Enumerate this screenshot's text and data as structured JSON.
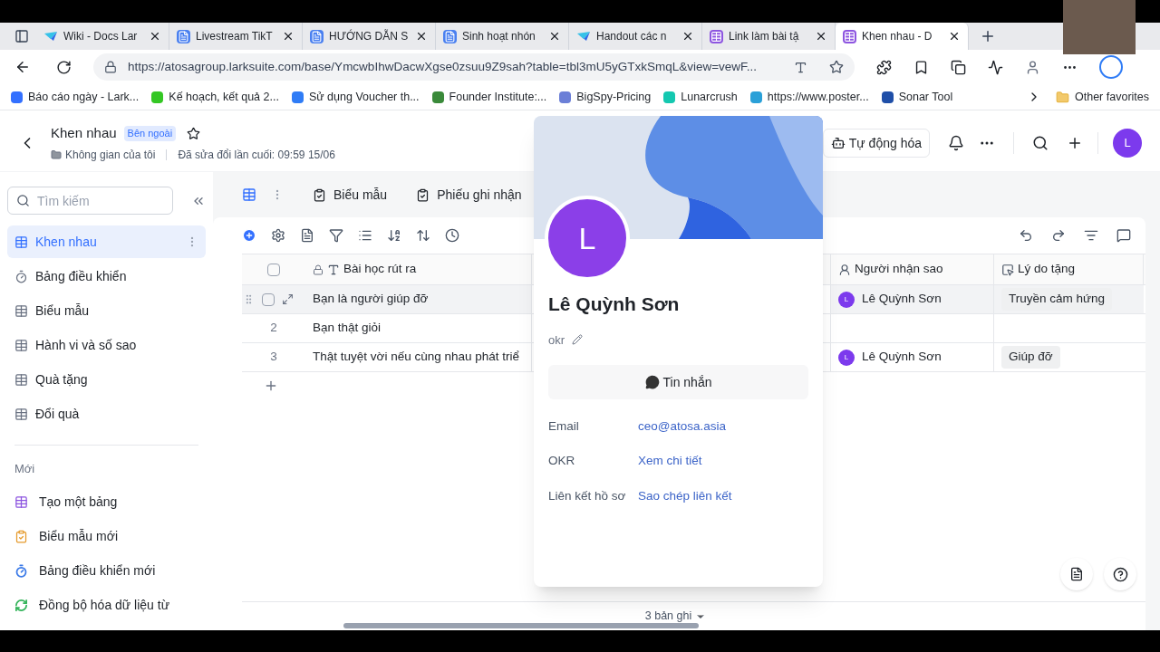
{
  "browser": {
    "tabs": [
      {
        "label": "Wiki - Docs Lar",
        "kind": "lark",
        "selected": false
      },
      {
        "label": "Livestream TikT",
        "kind": "doc",
        "selected": false
      },
      {
        "label": "HƯỚNG DẪN S",
        "kind": "doc",
        "selected": false
      },
      {
        "label": "Sinh hoạt nhón",
        "kind": "doc",
        "selected": false
      },
      {
        "label": "Handout các n",
        "kind": "lark",
        "selected": false
      },
      {
        "label": "Link làm bài tậ",
        "kind": "base",
        "selected": false
      },
      {
        "label": "Khen nhau - D",
        "kind": "base",
        "selected": true
      }
    ],
    "url": "https://atosagroup.larksuite.com/base/YmcwbIhwDacwXgse0zsuu9Z9sah?table=tbl3mU5yGTxkSmqL&view=vewF...",
    "bookmarks": [
      {
        "label": "Báo cáo ngày - Lark...",
        "color": "#3370ff"
      },
      {
        "label": "Kế hoạch, kết quả 2...",
        "color": "#34c724"
      },
      {
        "label": "Sử dụng Voucher th...",
        "color": "#2f7cf6"
      },
      {
        "label": "Founder Institute:...",
        "color": "#3a8a3a"
      },
      {
        "label": "BigSpy-Pricing",
        "color": "#6b7fd7"
      },
      {
        "label": "Lunarcrush",
        "color": "#14c8b0"
      },
      {
        "label": "https://www.poster...",
        "color": "#2aa0d8"
      },
      {
        "label": "Sonar Tool",
        "color": "#1f4fa8"
      }
    ],
    "other_favorites": "Other favorites"
  },
  "header": {
    "title": "Khen nhau",
    "badge": "Bên ngoài",
    "location": "Không gian của tôi",
    "modified": "Đã sửa đổi lần cuối: 09:59 15/06",
    "automation": "Tự động hóa",
    "avatar": "L"
  },
  "sidebar": {
    "search_placeholder": "Tìm kiếm",
    "items": [
      {
        "label": "Khen nhau",
        "kind": "table",
        "selected": true
      },
      {
        "label": "Bảng điều khiển",
        "kind": "dashboard",
        "selected": false
      },
      {
        "label": "Biểu mẫu",
        "kind": "table",
        "selected": false
      },
      {
        "label": "Hành vi và số sao",
        "kind": "table",
        "selected": false
      },
      {
        "label": "Quà tặng",
        "kind": "table",
        "selected": false
      },
      {
        "label": "Đổi quà",
        "kind": "table",
        "selected": false
      }
    ],
    "new_section": "Mới",
    "new_items": [
      {
        "label": "Tạo một bảng",
        "kind": "table",
        "color": "#8d55e0"
      },
      {
        "label": "Biểu mẫu mới",
        "kind": "form",
        "color": "#e59a2b"
      },
      {
        "label": "Bảng điều khiển mới",
        "kind": "dashboard",
        "color": "#3c7be8"
      },
      {
        "label": "Đồng bộ hóa dữ liệu từ",
        "kind": "sync",
        "color": "#34b45a"
      }
    ]
  },
  "views": [
    {
      "label": "Biểu mẫu"
    },
    {
      "label": "Phiếu ghi nhận"
    }
  ],
  "table": {
    "all_selected": false,
    "columns": [
      {
        "label": "Bài học rút ra",
        "kind": "text"
      },
      {
        "label": "Người nhận sao",
        "kind": "person"
      },
      {
        "label": "Lý do tặng",
        "kind": "tag"
      }
    ],
    "rows": [
      {
        "hovered": true,
        "lesson": "Bạn là người giúp đỡ",
        "recipient": {
          "initial": "L",
          "name": "Lê Quỳnh Sơn"
        },
        "reason": "Truyền cảm hứng"
      },
      {
        "index": "2",
        "hovered": false,
        "lesson": "Bạn thật giỏi"
      },
      {
        "index": "3",
        "hovered": false,
        "lesson": "Thật tuyệt vời nếu cùng nhau phát triể",
        "recipient": {
          "initial": "L",
          "name": "Lê Quỳnh Sơn"
        },
        "reason": "Giúp đỡ"
      }
    ],
    "record_count": "3 bản ghi"
  },
  "profile_card": {
    "initial": "L",
    "name": "Lê Quỳnh Sơn",
    "note": "okr",
    "message_button": "Tin nhắn",
    "fields": [
      {
        "label": "Email",
        "value": "ceo@atosa.asia"
      },
      {
        "label": "OKR",
        "value": "Xem chi tiết"
      },
      {
        "label": "Liên kết hồ sơ",
        "value": "Sao chép liên kết"
      }
    ]
  }
}
